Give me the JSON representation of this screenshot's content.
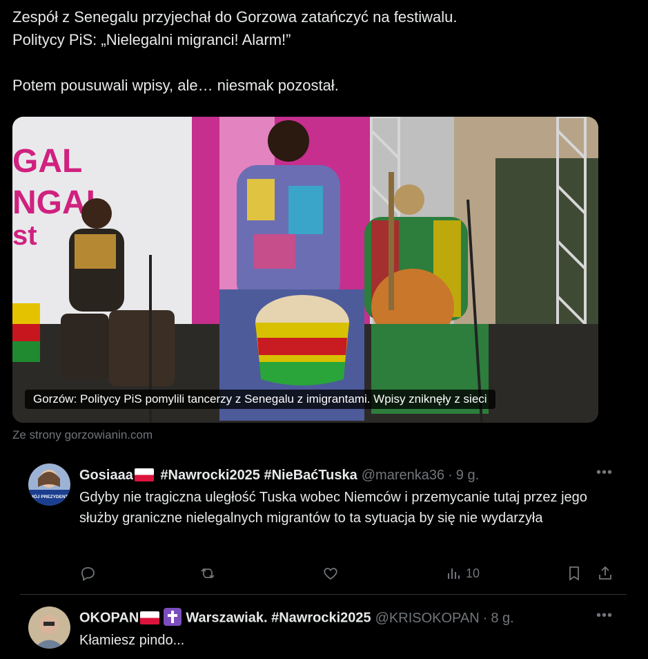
{
  "post": {
    "line1": "Zespół z Senegalu przyjechał do Gorzowa zatańczyć na festiwalu.",
    "line2": "Politycy PiS: „Nielegalni migranci! Alarm!”",
    "line3": "Potem pousuwali wpisy, ale… niesmak pozostał."
  },
  "card": {
    "caption": "Gorzów: Politycy PiS pomylili tancerzy z Senegalu z imigrantami. Wpisy zniknęły z sieci",
    "source": "Ze strony gorzowianin.com",
    "banner_text": [
      "GAL",
      "NGAL",
      "st"
    ]
  },
  "replies": [
    {
      "name": "Gosiaaa",
      "name_suffix": "#Nawrocki2025 #NieBaćTuska",
      "handle": "@marenka36",
      "time": "9 g.",
      "text": "Gdyby nie tragiczna uległość Tuska wobec Niemców i przemycanie tutaj przez jego służby graniczne nielegalnych migrantów to ta sytuacja by się nie wydarzyła",
      "avatar_text": "MÓJ PREZYDENT",
      "views": "10"
    },
    {
      "name": "OKOPAN",
      "name_suffix": "Warszawiak. #Nawrocki2025",
      "handle": "@KRISOKOPAN",
      "time": "8 g.",
      "text": "Kłamiesz pindo..."
    }
  ],
  "icons": {
    "more": "more-icon",
    "reply": "reply-icon",
    "repost": "repost-icon",
    "like": "like-icon",
    "views": "views-icon",
    "bookmark": "bookmark-icon",
    "share": "share-icon"
  },
  "colors": {
    "background": "#000000",
    "text": "#e7e9ea",
    "muted": "#71767b",
    "divider": "#2f3336"
  }
}
